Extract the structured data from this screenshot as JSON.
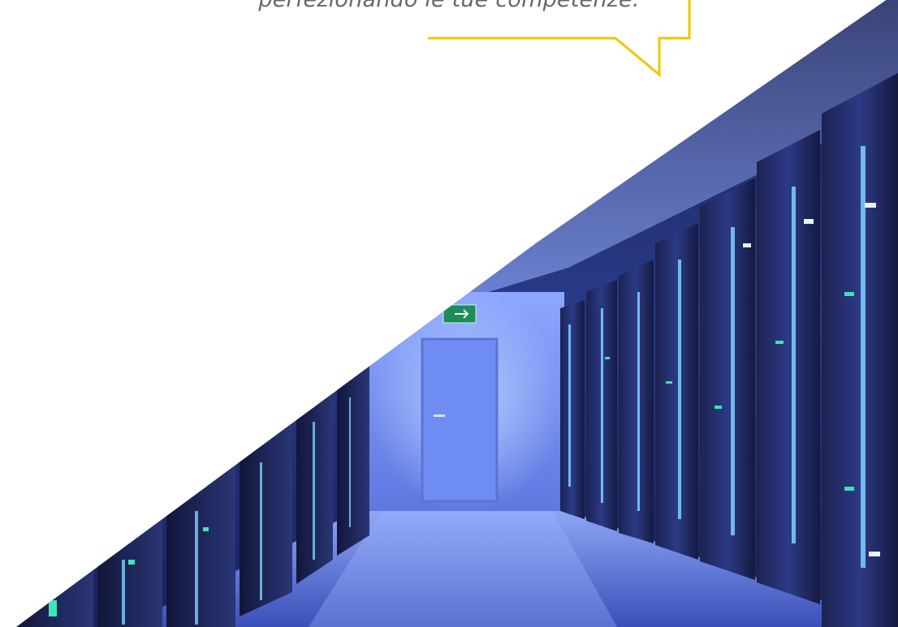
{
  "quote": {
    "text": "perfezionando le tue competenze."
  },
  "colors": {
    "bubble_outline": "#f2c500",
    "page_background": "#ffffff",
    "quote_text": "#666666"
  },
  "hero_image": {
    "subject": "server room corridor",
    "icon": "exit-sign"
  }
}
